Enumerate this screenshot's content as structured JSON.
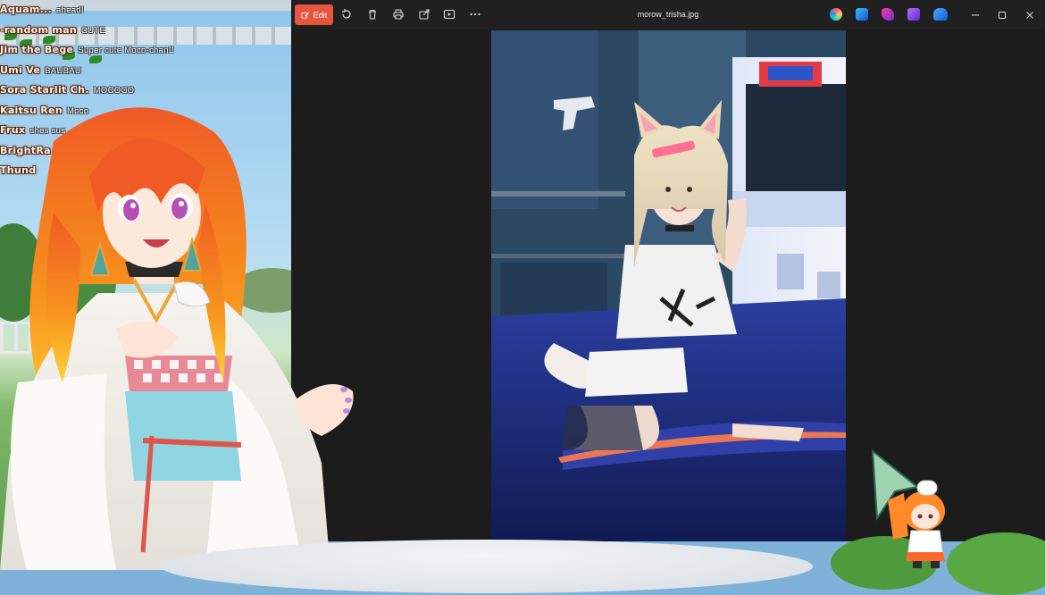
{
  "chat": {
    "lines": [
      {
        "author": "Aquam...",
        "message": "ahead!"
      },
      {
        "author": "-random man",
        "message": "CUTE"
      },
      {
        "author": "Jim the Bege",
        "message": "Super cute Moco-chan!!"
      },
      {
        "author": "Umi Ve",
        "message": "BAUBAU"
      },
      {
        "author": "Sora Starlit Ch.",
        "message": "MOCOCO"
      },
      {
        "author": "Kaitsu Ren",
        "message": "Moco"
      },
      {
        "author": "Frux",
        "message": "shes sus"
      },
      {
        "author": "BrightRa",
        "message": ""
      },
      {
        "author": "Thund",
        "message": ""
      }
    ]
  },
  "viewer": {
    "edit_label": "Edit",
    "file_name": "morow_trisha.jpg",
    "toolbar_icons": [
      "rotate-icon",
      "delete-icon",
      "print-icon",
      "share-icon",
      "slideshow-icon",
      "more-icon"
    ],
    "app_icons": [
      "copilot-icon",
      "designer-icon",
      "clipchamp-icon",
      "photos-icon",
      "onedrive-icon"
    ],
    "window_controls": [
      "minimize-icon",
      "maximize-icon",
      "close-icon"
    ]
  },
  "colors": {
    "edit_accent": "#e8553f",
    "titlebar": "#202020",
    "canvas": "#1c1c1c"
  }
}
